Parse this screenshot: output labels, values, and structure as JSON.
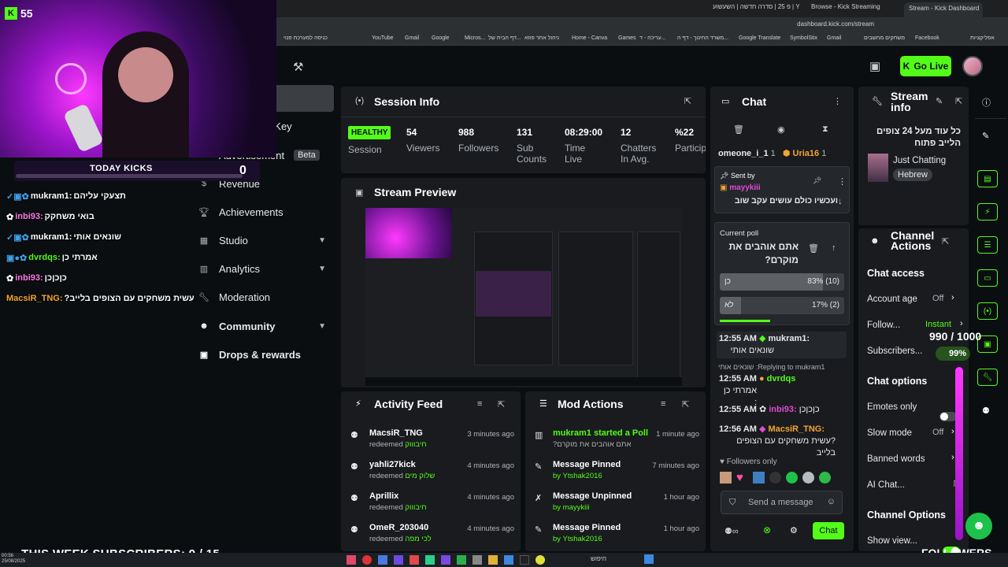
{
  "browser": {
    "tabs": [
      "Stream - Kick Dashboard",
      "Browse - Kick Streaming",
      "פ 25 | סדרה חדשה | השעשוע | YouTube"
    ],
    "url": "dashboard.kick.com/stream",
    "bookmarks": [
      "כניסה למערכת פנוי",
      "YouTube",
      "Gmail",
      "Google",
      "Micros...",
      "דף הבית של...",
      "ניהול אתר פוזא",
      "Home - Canva",
      "Games",
      "נייבים - ט...",
      "עריכה - ד...",
      "משרד החינוך - דף ה...",
      "Google Translate",
      "SymbolStix",
      "Gmail",
      "משחקים מחשבים",
      "Facebook",
      "אפליקציות"
    ]
  },
  "topnav": {
    "go_live": "Go Live"
  },
  "sidebar": {
    "items": [
      {
        "label": "& Key"
      },
      {
        "label": "Advertisement",
        "badge": "Beta"
      },
      {
        "label": "Revenue"
      },
      {
        "label": "Achievements"
      },
      {
        "label": "Studio"
      },
      {
        "label": "Analytics"
      },
      {
        "label": "Moderation"
      },
      {
        "label": "Community"
      },
      {
        "label": "Drops & rewards"
      }
    ]
  },
  "session": {
    "title": "Session Info",
    "status": "HEALTHY",
    "status_sub": "Session",
    "stats": [
      {
        "v": "54",
        "l1": "Viewers",
        "l2": ""
      },
      {
        "v": "988",
        "l1": "Followers",
        "l2": ""
      },
      {
        "v": "131",
        "l1": "Sub",
        "l2": "Counts"
      },
      {
        "v": "08:29:00",
        "l1": "Time",
        "l2": "Live"
      },
      {
        "v": "12",
        "l1": "Chatters",
        "l2": "In Avg."
      },
      {
        "v": "%22",
        "l1": "Particip",
        "l2": ""
      }
    ]
  },
  "preview": {
    "title": "Stream Preview"
  },
  "activity": {
    "title": "Activity Feed",
    "rows": [
      {
        "name": "MacsiR_TNG",
        "action": "redeemed",
        "reward": "חיבוווק",
        "time": "3 minutes ago"
      },
      {
        "name": "yahli27kick",
        "action": "redeemed",
        "reward": "שלוק מים",
        "time": "4 minutes ago"
      },
      {
        "name": "Aprillix",
        "action": "redeemed",
        "reward": "חיבוווק",
        "time": "4 minutes ago"
      },
      {
        "name": "OmeR_203040",
        "action": "redeemed",
        "reward": "לכי מפה",
        "time": "4 minutes ago"
      }
    ]
  },
  "mod": {
    "title": "Mod Actions",
    "rows": [
      {
        "title": "mukram1 started a Poll",
        "sub": "?אתם אוהבים את מוקרם",
        "time": "1 minute ago"
      },
      {
        "title": "Message Pinned",
        "sub": "by Ytshak2016",
        "time": "7 minutes ago"
      },
      {
        "title": "Message Unpinned",
        "sub": "by mayykiii",
        "time": "1 hour ago"
      },
      {
        "title": "Message Pinned",
        "sub": "by Ytshak2016",
        "time": "1 hour ago"
      }
    ]
  },
  "chat": {
    "title": "Chat",
    "top_users": [
      "omeone_i_1",
      "Uria16"
    ],
    "top_counts": [
      "1",
      "1"
    ],
    "pinned": {
      "label": "Sent by",
      "user": "mayykiii",
      "text": "ועכשיו כולם עושים עקב שוב"
    },
    "poll": {
      "label": "Current poll",
      "question": "אתם אוהבים את מוקרם?",
      "options": [
        {
          "label": "כן",
          "pct": "83% (10)",
          "fill": 0.83
        },
        {
          "label": "לא",
          "pct": "17% (2)",
          "fill": 0.17
        }
      ]
    },
    "messages": [
      {
        "time": "12:55 AM",
        "user": "mukram1:",
        "text": "שונאים אותי"
      },
      {
        "time": "12:55 AM",
        "user": "dvrdqs",
        "text": "אמרתי כן :",
        "reply": "Replying to mukram1: שונאים אותי"
      },
      {
        "time": "12:55 AM",
        "user": "inbi93:",
        "text": "כןכןכן"
      },
      {
        "time": "12:56 AM",
        "user": "MacsiR_TNG:",
        "text": "?עשית משחקים עם הצופים בלייב"
      }
    ],
    "mode": "Followers only",
    "placeholder": "Send a message",
    "send": "Chat"
  },
  "streaminfo": {
    "title": "Stream info",
    "title2": "כל עוד מעל 24 צופים הלייב פתוח",
    "category": "Just Chatting",
    "language": "Hebrew"
  },
  "channel": {
    "title": "Channel Actions",
    "access_head": "Chat access",
    "account_age": "Account age",
    "account_age_val": "Off",
    "follow": "Follow...",
    "follow_val": "Instant",
    "subscribers": "Subscribers...",
    "options_head": "Chat options",
    "emotes": "Emotes only",
    "slow": "Slow mode",
    "slow_val": "Off",
    "banned": "Banned words",
    "ai": "AI Chat...",
    "channel_opts": "Channel Options",
    "show_view": "Show view..."
  },
  "overlay": {
    "kick_count": "55",
    "today_kicks": "TODAY KICKS",
    "today_kicks_val": "0",
    "chat": [
      {
        "user": "mukram1:",
        "text": "תצעקי עליהם"
      },
      {
        "user": "inbi93:",
        "text": "בואי משחקק"
      },
      {
        "user": "mukram1:",
        "text": "שונאים אותי"
      },
      {
        "user": "dvrdqs:",
        "text": "אמרתי כן"
      },
      {
        "user": "inbi93:",
        "text": "כןכןכן"
      },
      {
        "user": "MacsiR_TNG:",
        "text": "?עשית משחקים עם הצופים בלייב"
      }
    ],
    "week_subs": "THIS WEEK SUBSCRIBERS: 9 / 15",
    "followers_goal": "990 / 1000",
    "followers_pct": "99%",
    "followers_label": "FOLLOWERS"
  },
  "taskbar": {
    "search": "חיפוש",
    "clock": "00:56",
    "date": "25/08/2025"
  }
}
